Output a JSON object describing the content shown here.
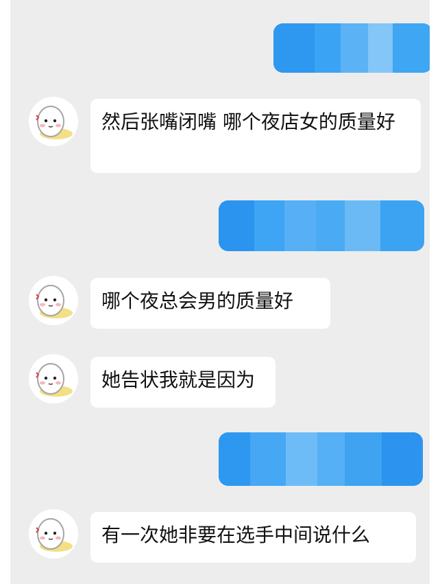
{
  "conversation": {
    "incoming": [
      {
        "text": "然后张嘴闭嘴 哪个夜店女的质量好"
      },
      {
        "text": "哪个夜总会男的质量好"
      },
      {
        "text": "她告状我就是因为"
      },
      {
        "text": "有一次她非要在选手中间说什么"
      }
    ],
    "outgoing_count": 3
  },
  "theme": {
    "background": "#ededed",
    "incoming_bubble": "#ffffff",
    "outgoing_bubble": "#2d9bf0"
  },
  "icons": {
    "avatar": "cartoon-blob-avatar-icon"
  }
}
